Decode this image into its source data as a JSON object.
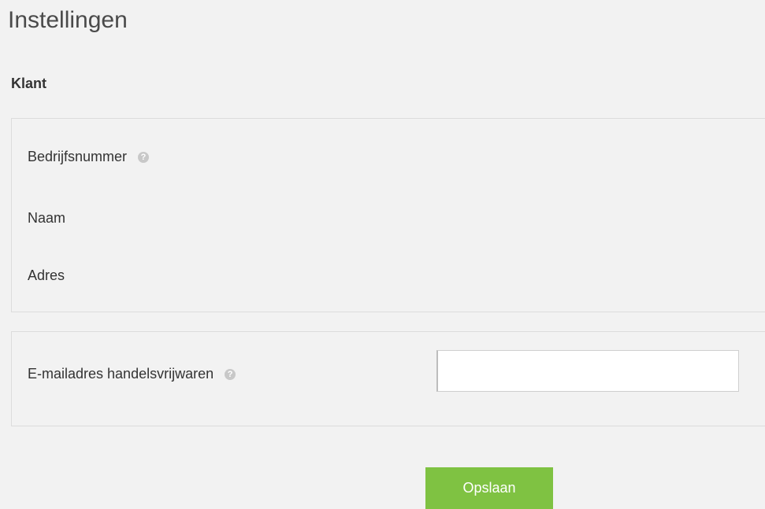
{
  "page": {
    "title": "Instellingen"
  },
  "section": {
    "title": "Klant"
  },
  "customer_info": {
    "company_number_label": "Bedrijfsnummer",
    "name_label": "Naam",
    "address_label": "Adres",
    "help_icon_glyph": "?"
  },
  "email_settings": {
    "label": "E-mailadres handelsvrijwaren",
    "value": "",
    "placeholder": "",
    "help_icon_glyph": "?"
  },
  "actions": {
    "save_label": "Opslaan"
  },
  "icons": {
    "help": "question-circle-icon"
  },
  "colors": {
    "background": "#f2f2f2",
    "panel_border": "#dcdcdc",
    "primary_button": "#7fc242",
    "help_icon": "#c8c8c8"
  }
}
